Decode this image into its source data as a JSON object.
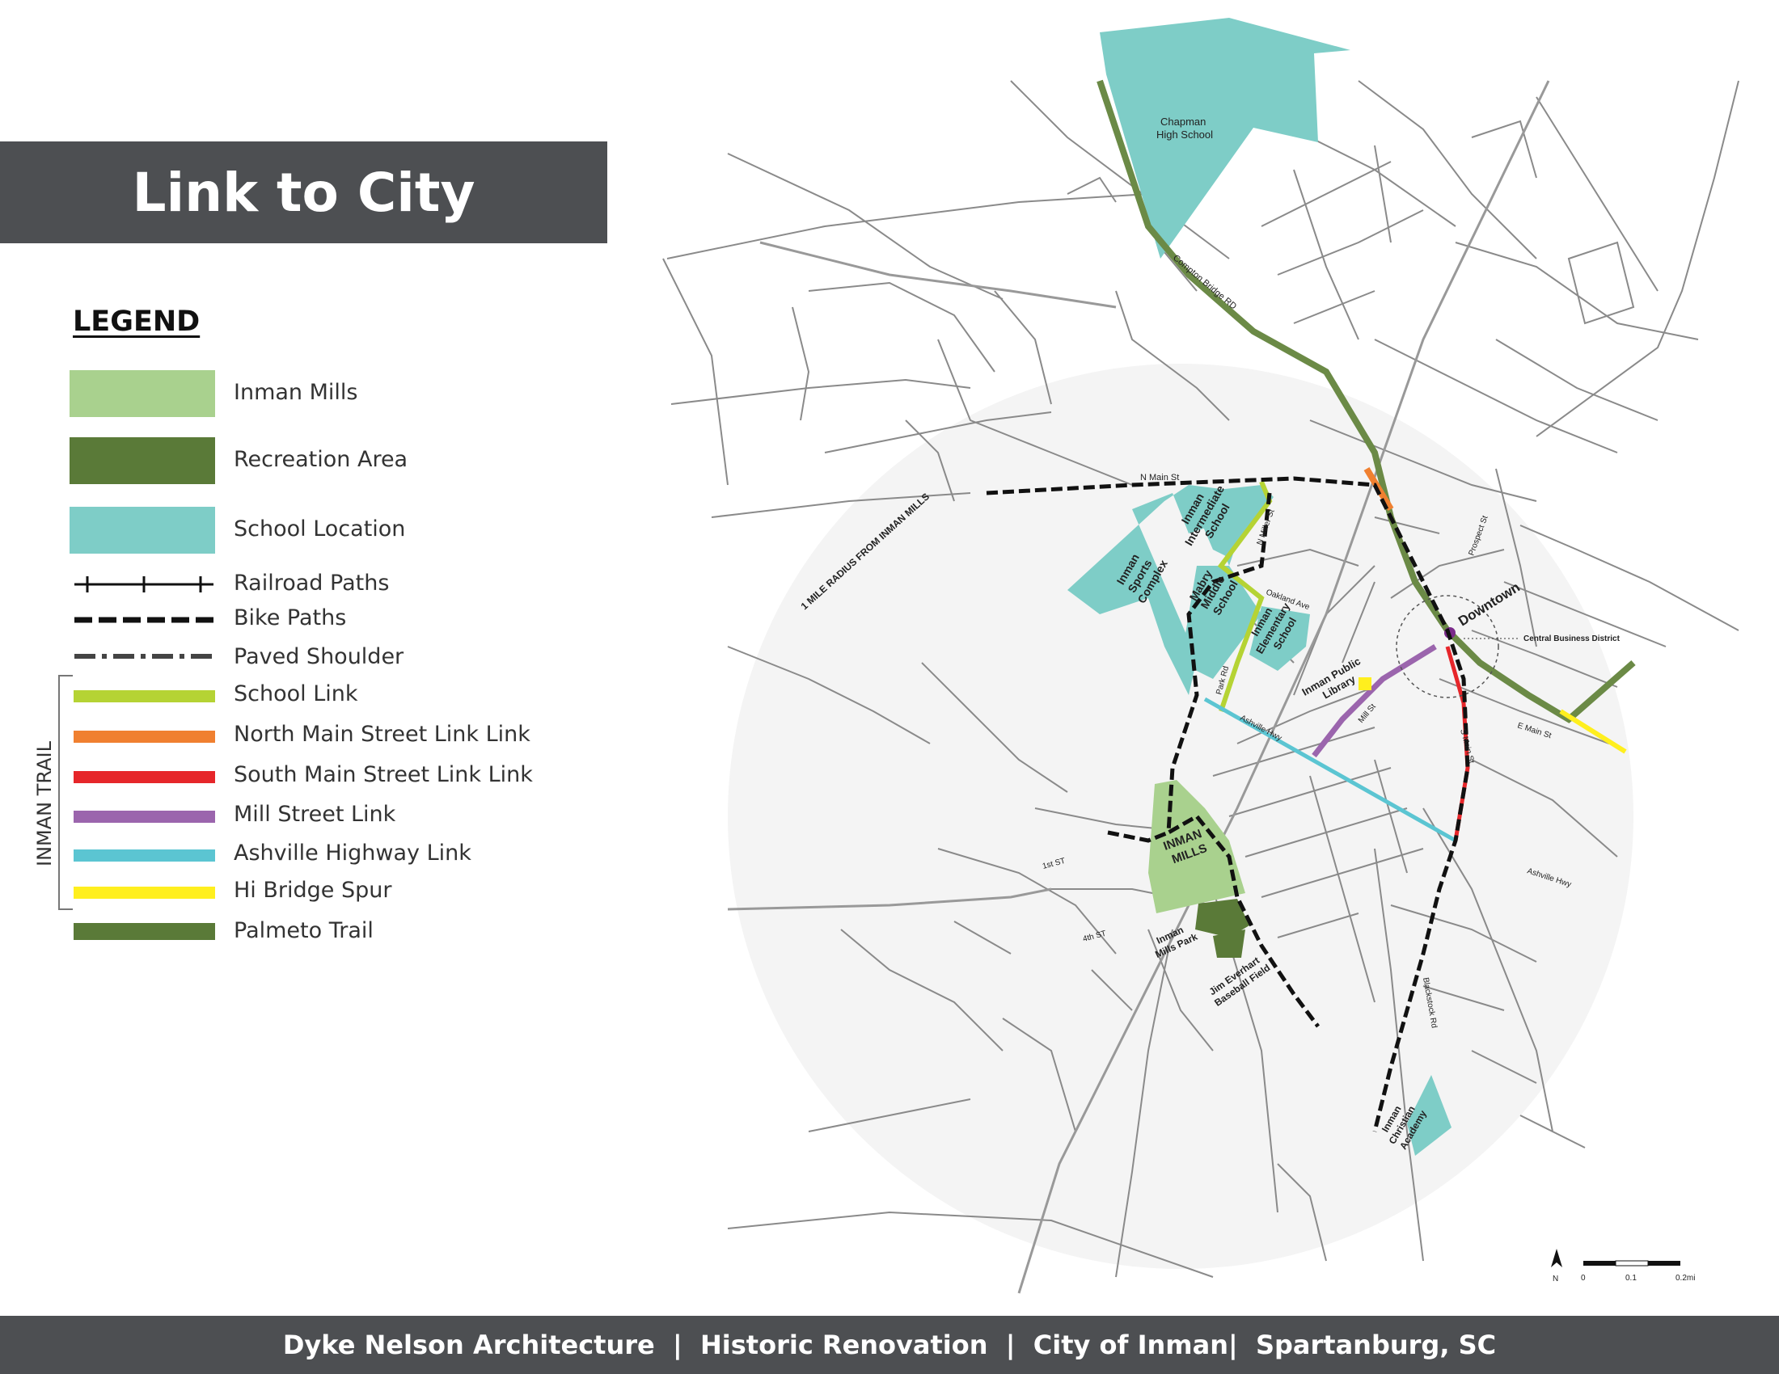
{
  "header": {
    "title": "Link to City"
  },
  "legend": {
    "heading": "LEGEND",
    "items": [
      {
        "label": "Inman Mills",
        "color": "#a9d18e",
        "icon": "swatch-box"
      },
      {
        "label": "Recreation Area",
        "color": "#5a7a38",
        "icon": "swatch-box"
      },
      {
        "label": "School Location",
        "color": "#7ecdc7",
        "icon": "swatch-box"
      },
      {
        "label": "Railroad Paths",
        "color": "#111111",
        "icon": "railroad-line-icon"
      },
      {
        "label": "Bike Paths",
        "color": "#111111",
        "icon": "dashed-line-icon"
      },
      {
        "label": "Paved Shoulder",
        "color": "#444444",
        "icon": "dash-dot-line-icon"
      },
      {
        "label": "School Link",
        "color": "#b5d334",
        "icon": "swatch-bar"
      },
      {
        "label": "North Main Street Link Link",
        "color": "#f08030",
        "icon": "swatch-bar"
      },
      {
        "label": "South Main Street Link Link",
        "color": "#e6262a",
        "icon": "swatch-bar"
      },
      {
        "label": "Mill Street Link",
        "color": "#9b65ad",
        "icon": "swatch-bar"
      },
      {
        "label": "Ashville Highway Link",
        "color": "#5bc5d2",
        "icon": "swatch-bar"
      },
      {
        "label": "Hi Bridge Spur",
        "color": "#ffef1e",
        "icon": "swatch-bar"
      },
      {
        "label": "Palmeto Trail",
        "color": "#5a7a38",
        "icon": "swatch-bar"
      }
    ],
    "inman_trail_label": "INMAN TRAIL"
  },
  "map": {
    "labels": {
      "chapman": [
        "Chapman",
        "High School"
      ],
      "compton": "Compton Bridge RD",
      "n_main": "N Main St",
      "radius": "1 MILE RADIUS FROM INMAN MILLS",
      "sports": [
        "Inman",
        "Sports",
        "Complex"
      ],
      "intermediate": [
        "Inman",
        "Intermediate",
        "School"
      ],
      "mabry": [
        "Mabry",
        "Middle",
        "School"
      ],
      "elementary": [
        "Inman",
        "Elementary",
        "School"
      ],
      "library": [
        "Inman Public",
        "Library"
      ],
      "downtown": "Downtown",
      "cbd": "Central Business District",
      "prospect": "Prospect St",
      "oakland": "Oakland Ave",
      "n_miller": "N Miller St",
      "park_rd": "Park Rd",
      "ashville_hwy": "Ashville Hwy",
      "mill_st": "Mill St",
      "e_main": "E Main St",
      "s_main": "S Main St",
      "inman_mills": [
        "INMAN",
        "MILLS"
      ],
      "first_st": "1st ST",
      "fourth_st": "4th ST",
      "mills_park": [
        "Inman",
        "Mills Park"
      ],
      "jim_everhart": [
        "Jim Everhart",
        "Baseball Field"
      ],
      "christian": [
        "Inman",
        "Christian",
        "Academy"
      ],
      "ashville_hwy2": "Ashville Hwy",
      "blackstock": "Blackstock Rd",
      "north": "N",
      "scale": [
        "0",
        "0.1",
        "0.2mi"
      ]
    },
    "colors": {
      "school": "#7ecdc7",
      "mills": "#a9d18e",
      "recreation": "#5a7a38",
      "palmetto": "#6b8a46",
      "school_link": "#b5d334",
      "north_main": "#f08030",
      "south_main": "#e6262a",
      "mill_st": "#9b65ad",
      "ashville": "#5bc5d2",
      "hi_bridge": "#ffef1e",
      "radius_fill": "#f4f4f4"
    }
  },
  "footer": {
    "text": "Dyke Nelson Architecture  |  Historic Renovation  |  City of Inman|  Spartanburg, SC"
  }
}
